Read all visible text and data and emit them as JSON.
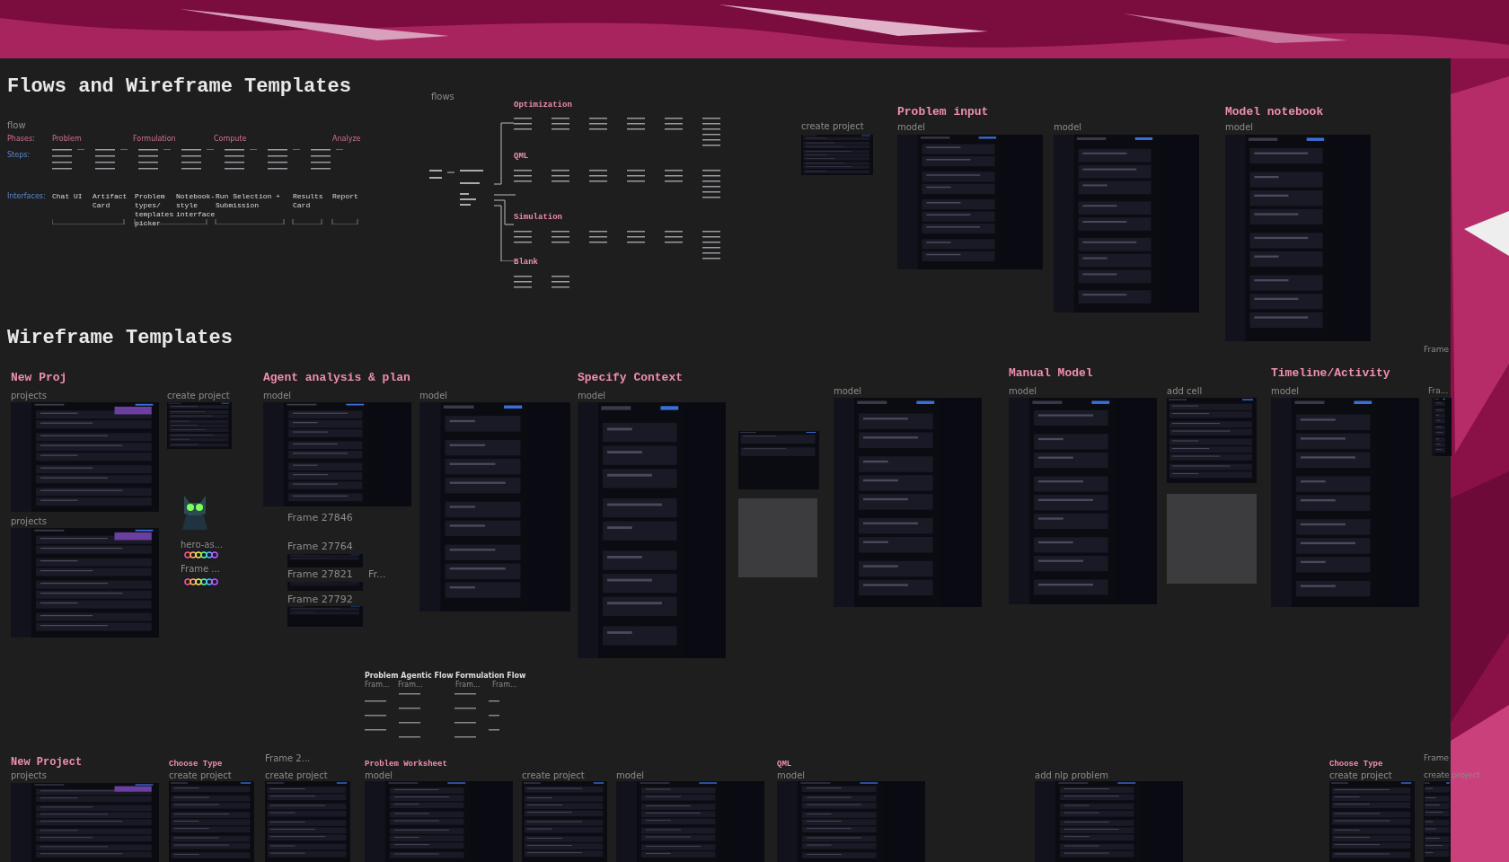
{
  "canvas": {
    "titles": [
      "Flows and Wireframe Templates",
      "Wireframe Templates"
    ],
    "flow_table": {
      "caption": "flow",
      "row_labels": [
        "Phases:",
        "Steps:",
        "Interfaces:"
      ],
      "phases": [
        "Problem",
        "Formulation",
        "Compute",
        "Analyze"
      ],
      "interfaces": [
        "Chat UI",
        "Artifact Card",
        "Problem types/ templates picker",
        "Notebook-style interface",
        "Run Selection + Submission",
        "Results Card",
        "Report"
      ]
    },
    "flows_diagram": {
      "caption": "flows",
      "branches": [
        "Optimization",
        "QML",
        "Simulation",
        "Blank"
      ]
    },
    "section_headings": [
      "Problem input",
      "Model notebook",
      "New Proj",
      "Agent analysis & plan",
      "Specify Context",
      "Manual Model",
      "Timeline/Activity",
      "New Project",
      "Choose Type",
      "Problem Worksheet",
      "QML",
      "Choose Type"
    ],
    "frame_labels": [
      "create project",
      "model",
      "model",
      "model",
      "Frame",
      "projects",
      "create project",
      "model",
      "model",
      "model",
      "model",
      "model",
      "add cell",
      "model",
      "Fra...",
      "projects",
      "hero-as...",
      "Frame ...",
      "Frame 27846",
      "Frame 27764",
      "Frame 27821",
      "Fr...",
      "Frame 27792",
      "Fram...",
      "Fram...",
      "Fram...",
      "Fram...",
      "projects",
      "Frame 2...",
      "create project",
      "create project",
      "model",
      "create project",
      "model",
      "model",
      "add nlp problem",
      "create project",
      "Frame",
      "create project"
    ],
    "notes": [
      "Problem Agentic Flow",
      "Formulation Flow"
    ]
  }
}
